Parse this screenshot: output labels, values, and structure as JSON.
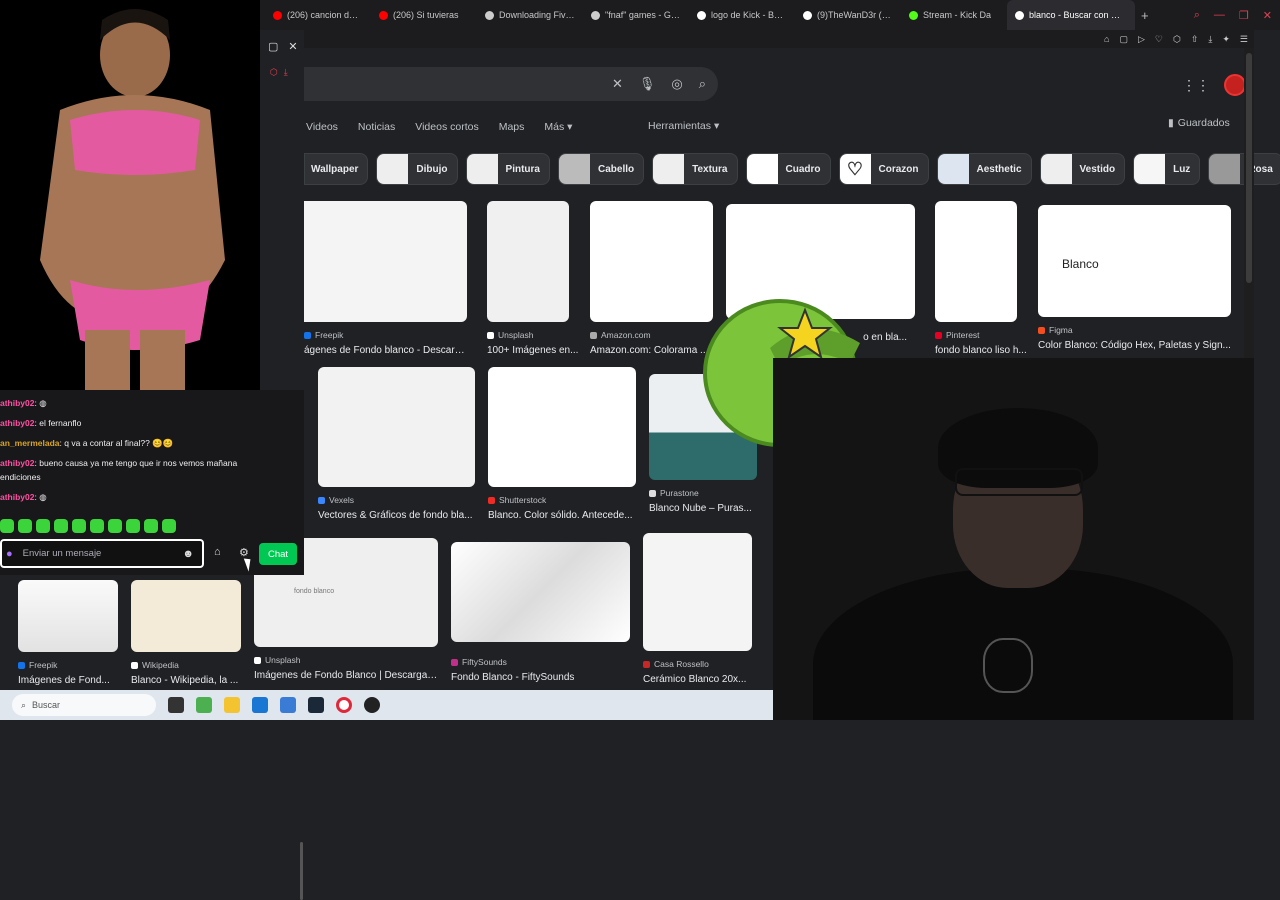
{
  "browser": {
    "tabs": [
      {
        "label": "(206) cancion de ns",
        "icon": "youtube-icon",
        "color": "#ff0000"
      },
      {
        "label": "(206) Si tuvieras",
        "icon": "youtube-icon",
        "color": "#ff0000"
      },
      {
        "label": "Downloading Five N",
        "icon": "bolt-icon",
        "color": "#cccccc"
      },
      {
        "label": "\"fnaf\" games - Gam",
        "icon": "bolt-icon",
        "color": "#cccccc"
      },
      {
        "label": "logo de Kick - Busc",
        "icon": "google-icon",
        "color": "#ffffff"
      },
      {
        "label": "(9)TheWanD3r (@th",
        "icon": "tiktok-icon",
        "color": "#ffffff"
      },
      {
        "label": "Stream - Kick Da",
        "icon": "kick-icon",
        "color": "#53fc18"
      },
      {
        "label": "blanco - Buscar con Goog",
        "icon": "google-icon",
        "color": "#ffffff",
        "active": true
      }
    ]
  },
  "search": {
    "nav_tabs": [
      "Videos",
      "Noticias",
      "Videos cortos",
      "Maps",
      "Más"
    ],
    "tools": "Herramientas",
    "saved": "Guardados",
    "chips": [
      "Wallpaper",
      "Dibujo",
      "Pintura",
      "Cabello",
      "Textura",
      "Cuadro",
      "Corazon",
      "Aesthetic",
      "Vestido",
      "Luz",
      "Rosa"
    ],
    "results_row1": [
      {
        "source": "Freepik",
        "title": "ágenes de Fondo blanco - Descarg..."
      },
      {
        "source": "Unsplash",
        "title": "100+ Imágenes en..."
      },
      {
        "source": "Amazon.com",
        "title": "Amazon.com: Colorama ..."
      },
      {
        "source": "",
        "title": "o en bla..."
      },
      {
        "source": "Pinterest",
        "title": "fondo blanco liso h..."
      },
      {
        "source": "Figma",
        "title": "Color Blanco: Código Hex, Paletas y Sign..."
      }
    ],
    "blanco_label": "Blanco",
    "results_row2": [
      {
        "source": "Vexels",
        "title": "Vectores & Gráficos de fondo bla..."
      },
      {
        "source": "Shutterstock",
        "title": "Blanco. Color sólido. Antecede..."
      },
      {
        "source": "Purastone",
        "title": "Blanco Nube – Puras..."
      }
    ],
    "results_row3": [
      {
        "source": "Freepik",
        "title": "Imágenes de Fond..."
      },
      {
        "source": "Wikipedia",
        "title": "Blanco - Wikipedia, la ..."
      },
      {
        "source": "Unsplash",
        "title": "Imágenes de Fondo Blanco | Descarga ..."
      },
      {
        "source": "FiftySounds",
        "title": "Fondo Blanco - FiftySounds"
      },
      {
        "source": "Casa Rossello",
        "title": "Cerámico Blanco 20x..."
      }
    ],
    "fondo_blanco_watermark": "fondo blanco"
  },
  "chat": {
    "messages": [
      {
        "user": "athiby02",
        "text": "",
        "alt": false
      },
      {
        "user": "athiby02",
        "text": "el fernanflo",
        "alt": false
      },
      {
        "user": "an_mermelada",
        "text": "q va a contar al final?? 😊😊",
        "alt": true
      },
      {
        "user": "athiby02",
        "text": "bueno causa ya me tengo que ir nos vemos mañana",
        "alt": false,
        "cont": "endiciones"
      },
      {
        "user": "athiby02",
        "text": "",
        "alt": false
      }
    ],
    "placeholder": "Enviar un mensaje",
    "chat_button": "Chat"
  },
  "taskbar": {
    "search_placeholder": "Buscar"
  }
}
